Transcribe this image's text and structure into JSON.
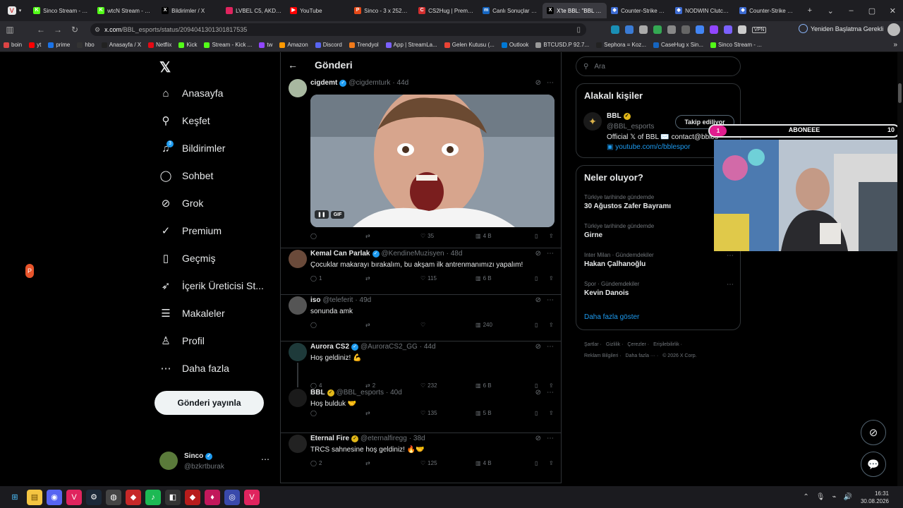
{
  "tabs": [
    {
      "label": "Sinco Stream - Kick",
      "icon": "K",
      "color": "#53fc18"
    },
    {
      "label": "wtcN Stream - Watch",
      "icon": "K",
      "color": "#53fc18"
    },
    {
      "label": "Bildirimler / X",
      "icon": "X",
      "color": "#000000"
    },
    {
      "label": "LVBEL C5, AKDO - ",
      "icon": "",
      "color": "#e0245e"
    },
    {
      "label": "YouTube",
      "icon": "▶",
      "color": "#ff0000"
    },
    {
      "label": "Sinco - 3 x 2525 VP",
      "icon": "P",
      "color": "#e64a19"
    },
    {
      "label": "CS2Hug | Premium",
      "icon": "C",
      "color": "#d32f2f"
    },
    {
      "label": "Canlı Sonuçlar - İddia",
      "icon": "m",
      "color": "#1565c0"
    },
    {
      "label": "X'te BBL: \"BBL CS2",
      "icon": "X",
      "color": "#000000"
    },
    {
      "label": "Counter-Strike Ran",
      "icon": "◆",
      "color": "#3d6bd1"
    },
    {
      "label": "NODWIN Clutch Se",
      "icon": "◆",
      "color": "#3d6bd1"
    },
    {
      "label": "Counter-Strike Ran",
      "icon": "◆",
      "color": "#3d6bd1"
    }
  ],
  "url": {
    "prefix": "x.com",
    "path": "/BBL_esports/status/2094041301301817535"
  },
  "restart_label": "Yeniden Başlatma Gerekli",
  "bookmarks": [
    "boin",
    "yt",
    "prime",
    "hbo",
    "Anasayfa / X",
    "Netflix",
    "Kick",
    "Stream - Kick ...",
    "tw",
    "Amazon",
    "Discord",
    "Trendyol",
    "App | StreamLa...",
    "Gelen Kutusu (...",
    "Outlook",
    "BTCUSD.P 92.7...",
    "Sephora = Koz...",
    "CaseHug x Sin...",
    "Sinco Stream - ..."
  ],
  "nav": [
    {
      "label": "Anasayfa",
      "icon": "home-icon",
      "glyph": "⌂"
    },
    {
      "label": "Keşfet",
      "icon": "search-icon",
      "glyph": "⚲"
    },
    {
      "label": "Bildirimler",
      "icon": "bell-icon",
      "glyph": "♫"
    },
    {
      "label": "Sohbet",
      "icon": "chat-icon",
      "glyph": "◯"
    },
    {
      "label": "Grok",
      "icon": "grok-icon",
      "glyph": "⊘"
    },
    {
      "label": "Premium",
      "icon": "premium-icon",
      "glyph": "✓"
    },
    {
      "label": "Geçmiş",
      "icon": "bookmark-icon",
      "glyph": "▯"
    },
    {
      "label": "İçerik Üreticisi St...",
      "icon": "rocket-icon",
      "glyph": "➶"
    },
    {
      "label": "Makaleler",
      "icon": "article-icon",
      "glyph": "☰"
    },
    {
      "label": "Profil",
      "icon": "profile-icon",
      "glyph": "♙"
    },
    {
      "label": "Daha fazla",
      "icon": "more-icon",
      "glyph": "⋯"
    }
  ],
  "notif_count": "3",
  "post_button": "Gönderi yayınla",
  "me": {
    "name": "Sinco",
    "handle": "@bzkrtburak"
  },
  "header_title": "Gönderi",
  "gif_label": "GIF",
  "posts": [
    {
      "name": "cigdemt",
      "badge": "blue",
      "handle": "@cigdemturk",
      "time": "· 44d",
      "text": "",
      "reply": "",
      "rt": "",
      "like": "35",
      "views": "4 B"
    },
    {
      "name": "Kemal Can Parlak",
      "badge": "blue",
      "handle": "@KendineMuzisyen",
      "time": "· 48d",
      "text": "Çocuklar makarayı bırakalım, bu akşam ilk antrenmanımızı yapalım!",
      "reply": "1",
      "rt": "",
      "like": "115",
      "views": "6 B"
    },
    {
      "name": "iso",
      "badge": "",
      "handle": "@teleferit",
      "time": "· 49d",
      "text": "sonunda amk",
      "reply": "",
      "rt": "",
      "like": "",
      "views": "240"
    },
    {
      "name": "Aurora CS2",
      "badge": "blue",
      "handle": "@AuroraCS2_GG",
      "time": "· 44d",
      "text": "Hoş geldiniz! 💪",
      "reply": "4",
      "rt": "2",
      "like": "232",
      "views": "6 B"
    },
    {
      "name": "BBL",
      "badge": "gold",
      "handle": "@BBL_esports",
      "time": "· 40d",
      "text": "Hoş bulduk 🤝",
      "reply": "",
      "rt": "",
      "like": "135",
      "views": "5 B"
    },
    {
      "name": "Eternal Fire",
      "badge": "gold",
      "handle": "@eternalfiregg",
      "time": "· 38d",
      "text": "TRCS sahnesine hoş geldiniz! 🔥🤝",
      "reply": "2",
      "rt": "",
      "like": "125",
      "views": "4 B"
    }
  ],
  "search_placeholder": "Ara",
  "related": {
    "title": "Alakalı kişiler",
    "name": "BBL",
    "handle": "@BBL_esports",
    "follow": "Takip ediliyor",
    "bio": "Official 𝕏 of BBL ✉️ contact@bbles",
    "link": "▣ youtube.com/c/bblespor"
  },
  "trends_title": "Neler oluyor?",
  "trends": [
    {
      "cat": "Türkiye tarihinde gündemde",
      "name": "30 Ağustos Zafer Bayramı"
    },
    {
      "cat": "Türkiye tarihinde gündemde",
      "name": "Girne"
    },
    {
      "cat": "Inter Milan · Gündemdekiler",
      "name": "Hakan Çalhanoğlu"
    },
    {
      "cat": "Spor · Gündemdekiler",
      "name": "Kevin Danois"
    }
  ],
  "show_more": "Daha fazla göster",
  "footer": [
    "Şartlar ·",
    "Gizlilik ·",
    "Çerezler ·",
    "Erişilebilirlik ·",
    "Reklam Bilgileri ·",
    "Daha fazla ··· ·",
    "© 2026 X Corp."
  ],
  "overlay": {
    "left": "1",
    "label": "ABONEEE",
    "right": "10"
  },
  "clock": {
    "time": "16:31",
    "date": "30.08.2026"
  },
  "colors": {
    "accent": "#1d9bf0",
    "bg": "#000000",
    "border": "#2f3336",
    "muted": "#71767b"
  }
}
